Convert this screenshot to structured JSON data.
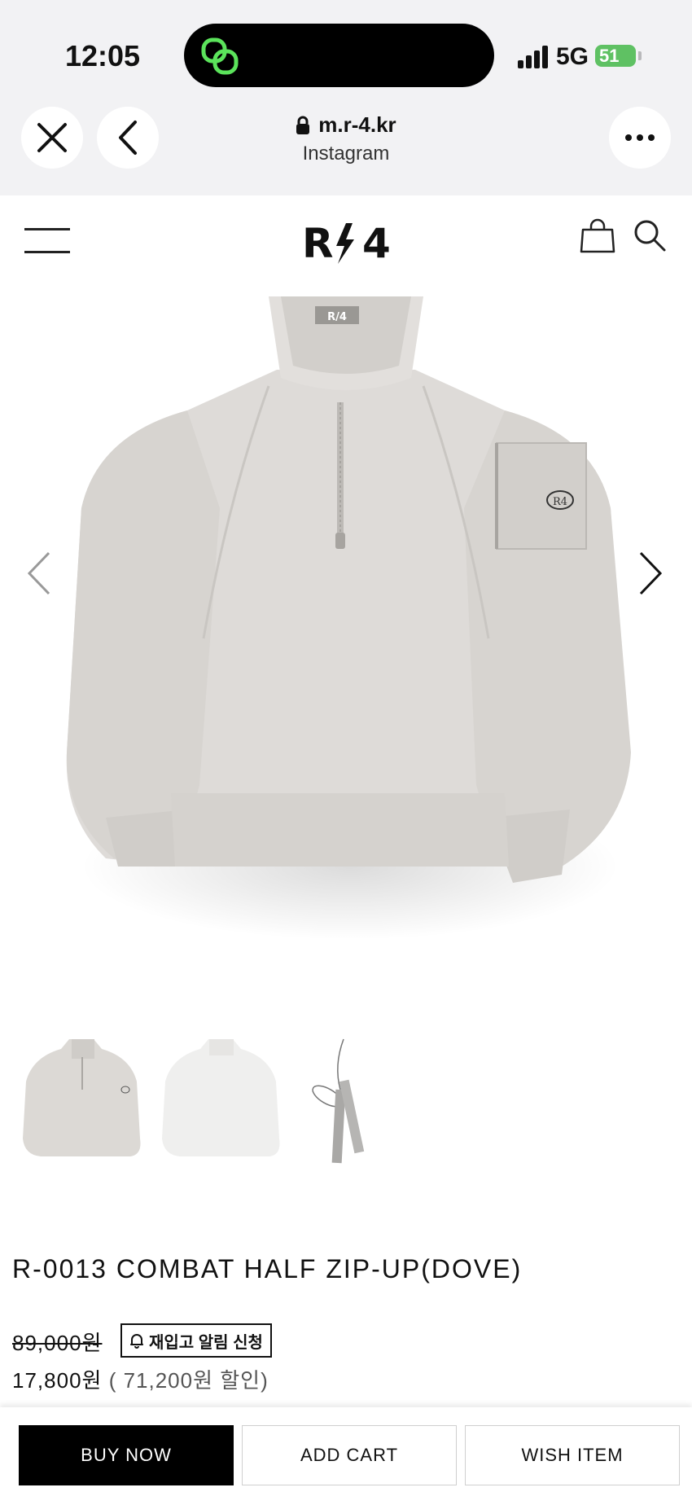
{
  "status_bar": {
    "time": "12:05",
    "network": "5G",
    "battery": "51"
  },
  "browser": {
    "domain": "m.r-4.kr",
    "source": "Instagram"
  },
  "site": {
    "logo_text": "R/4"
  },
  "product": {
    "title": "R-0013 COMBAT HALF ZIP-UP(DOVE)",
    "original_price": "89,000원",
    "restock_label": "재입고 알림 신청",
    "sale_price": "17,800원",
    "discount_text": "( 71,200원 할인)",
    "label_tag": "R/4",
    "patch_text": "R4"
  },
  "bottom_bar": {
    "buy_now": "BUY NOW",
    "add_cart": "ADD CART",
    "wish_item": "WISH ITEM"
  },
  "colors": {
    "garment": "#dedbd8",
    "garment_shadow": "#cdcac6",
    "accent_black": "#000000",
    "battery_green": "#5fc163"
  }
}
